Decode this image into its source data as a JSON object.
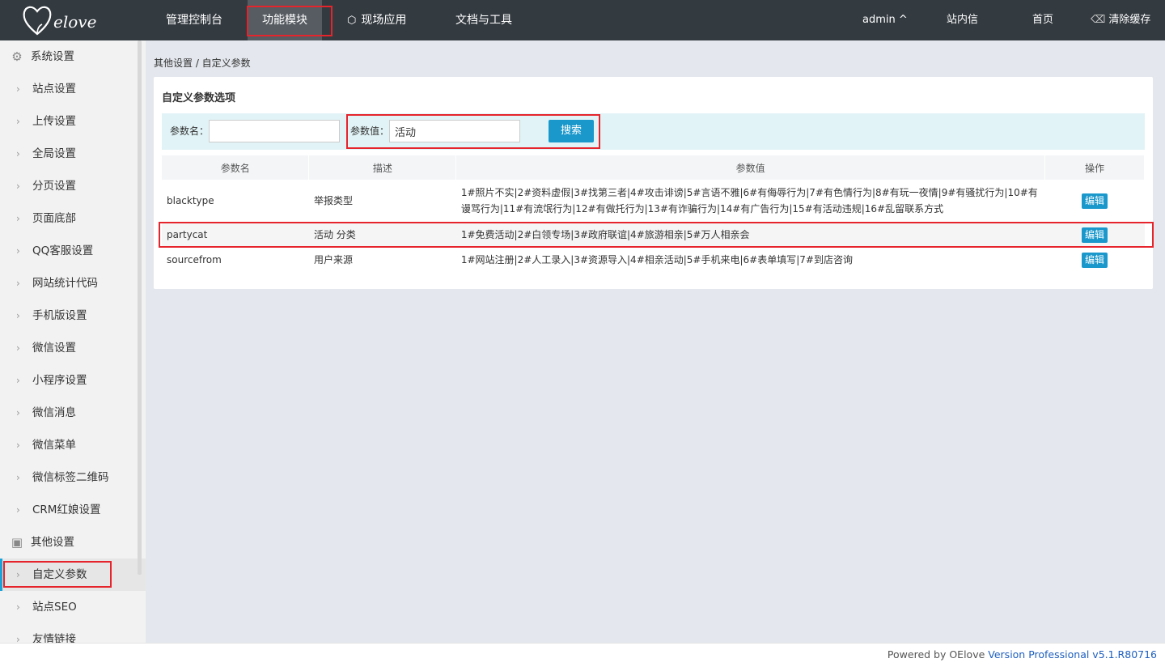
{
  "brand": {
    "logo_text": "Uelove"
  },
  "top_nav": {
    "items": [
      "管理控制台",
      "功能模块",
      "现场应用",
      "文档与工具"
    ],
    "active": "功能模块",
    "user": "admin ^",
    "messages": "站内信",
    "home": "首页",
    "clear_cache": "清除缓存"
  },
  "sidebar": {
    "group1": "系统设置",
    "items1": [
      "站点设置",
      "上传设置",
      "全局设置",
      "分页设置",
      "页面底部",
      "QQ客服设置",
      "网站统计代码",
      "手机版设置",
      "微信设置",
      "小程序设置",
      "微信消息",
      "微信菜单",
      "微信标签二维码",
      "CRM红娘设置"
    ],
    "group2": "其他设置",
    "items2": [
      "自定义参数",
      "站点SEO",
      "友情链接"
    ],
    "active": "自定义参数"
  },
  "breadcrumb": "其他设置 / 自定义参数",
  "panel": {
    "title": "自定义参数选项",
    "search": {
      "name_label": "参数名：",
      "name_value": "",
      "value_label": "参数值：",
      "value_value": "活动",
      "button": "搜索"
    },
    "columns": [
      "参数名",
      "描述",
      "参数值",
      "操作"
    ],
    "rows": [
      {
        "name": "blacktype",
        "desc": "举报类型",
        "value": "1#照片不实|2#资料虚假|3#找第三者|4#攻击诽谤|5#言语不雅|6#有侮辱行为|7#有色情行为|8#有玩一夜情|9#有骚扰行为|10#有谩骂行为|11#有流氓行为|12#有做托行为|13#有诈骗行为|14#有广告行为|15#有活动违规|16#乱留联系方式",
        "action": "编辑"
      },
      {
        "name": "partycat",
        "desc": "活动 分类",
        "value": "1#免费活动|2#白领专场|3#政府联谊|4#旅游相亲|5#万人相亲会",
        "action": "编辑"
      },
      {
        "name": "sourcefrom",
        "desc": "用户来源",
        "value": "1#网站注册|2#人工录入|3#资源导入|4#相亲活动|5#手机来电|6#表单填写|7#到店咨询",
        "action": "编辑"
      }
    ]
  },
  "footer": {
    "prefix": "Powered by OElove ",
    "version": "Version Professional v5.1.R80716"
  },
  "colors": {
    "topbar": "#333a40",
    "accent": "#1a98cc",
    "highlight": "#e5242b"
  }
}
